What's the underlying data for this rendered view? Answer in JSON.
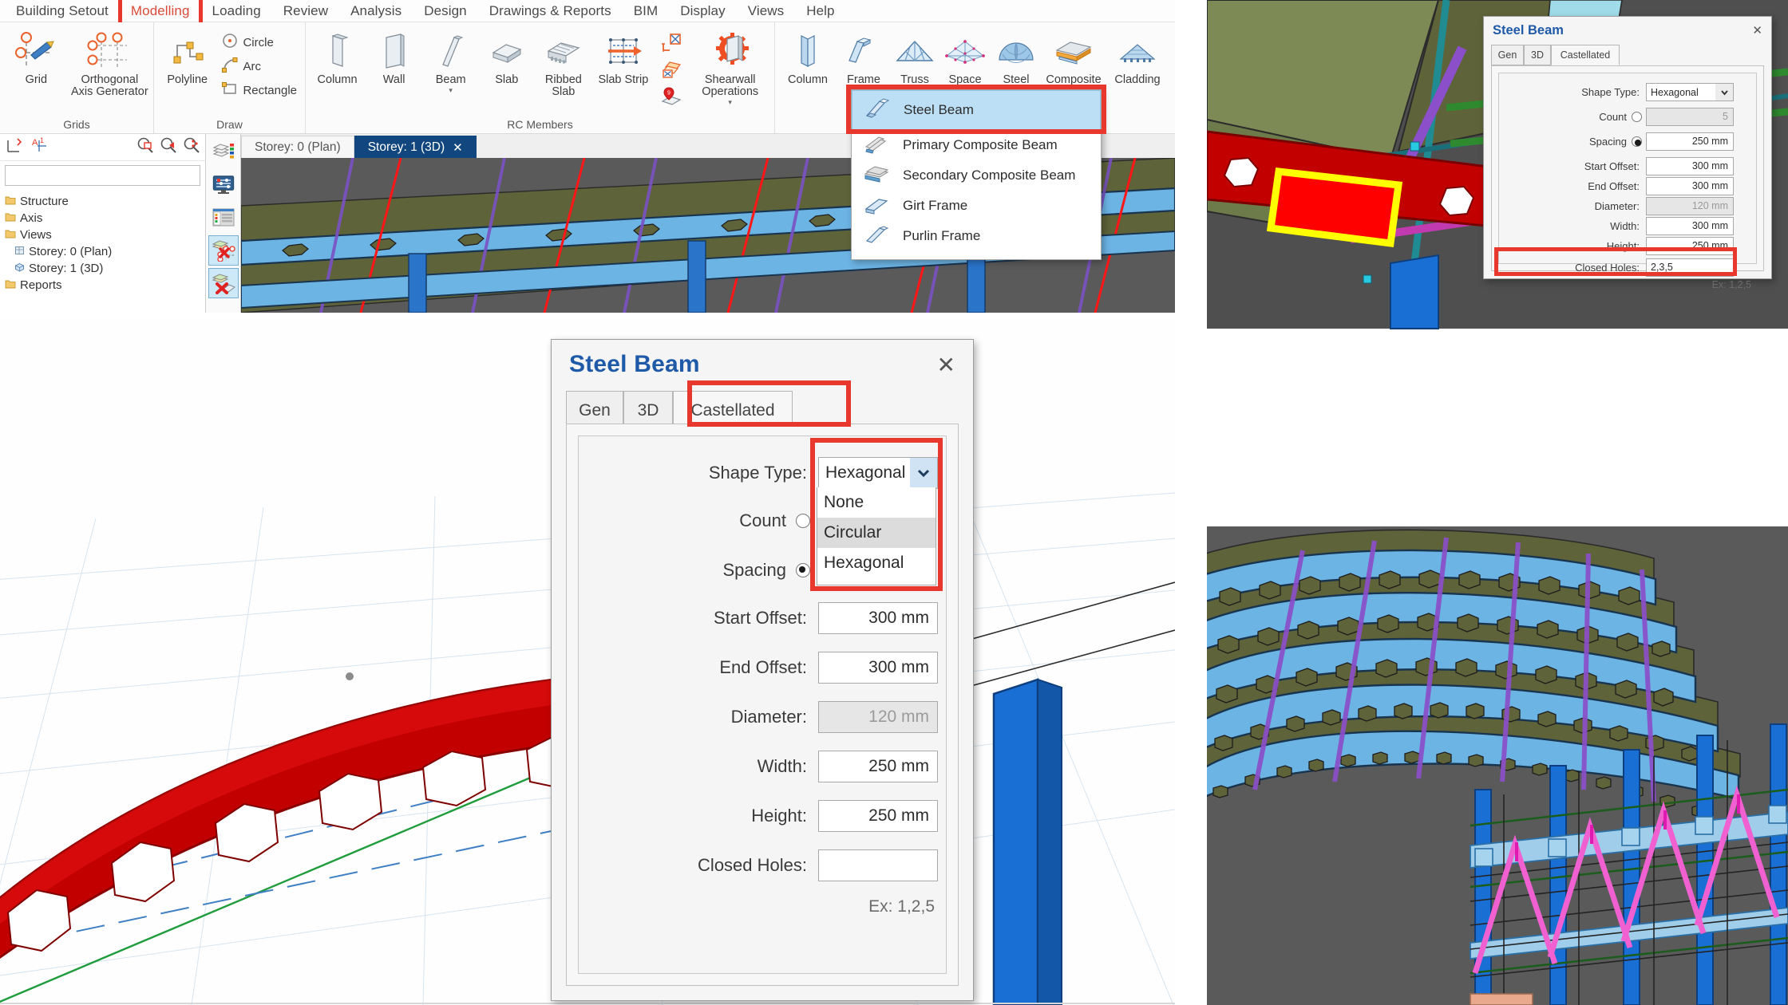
{
  "app": {
    "menu": [
      "Building Setout",
      "Modelling",
      "Loading",
      "Review",
      "Analysis",
      "Design",
      "Drawings & Reports",
      "BIM",
      "Display",
      "Views",
      "Help"
    ],
    "active_menu": "Modelling"
  },
  "ribbon": {
    "groups": [
      {
        "label": "Grids",
        "buttons": [
          {
            "name": "grid",
            "caption": "Grid",
            "icon": "grid-icon"
          },
          {
            "name": "orthogonal-axis-generator",
            "caption": "Orthogonal Axis Generator",
            "icon": "axis-generator-icon"
          }
        ]
      },
      {
        "label": "Draw",
        "buttons": [
          {
            "name": "polyline",
            "caption": "Polyline",
            "icon": "polyline-icon"
          }
        ],
        "small_buttons": [
          {
            "name": "circle",
            "caption": "Circle",
            "icon": "circle-icon"
          },
          {
            "name": "arc",
            "caption": "Arc",
            "icon": "arc-icon"
          },
          {
            "name": "rectangle",
            "caption": "Rectangle",
            "icon": "rectangle-icon"
          }
        ]
      },
      {
        "label": "RC Members",
        "buttons": [
          {
            "name": "column",
            "caption": "Column",
            "icon": "column-icon"
          },
          {
            "name": "wall",
            "caption": "Wall",
            "icon": "wall-icon"
          },
          {
            "name": "beam",
            "caption": "Beam",
            "icon": "beam-icon",
            "dropdown": true
          },
          {
            "name": "slab",
            "caption": "Slab",
            "icon": "slab-icon"
          },
          {
            "name": "ribbed-slab",
            "caption": "Ribbed Slab",
            "icon": "ribbed-slab-icon"
          },
          {
            "name": "slab-strip",
            "caption": "Slab Strip",
            "icon": "slab-strip-icon"
          },
          {
            "name": "shearwall-operations",
            "caption": "Shearwall Operations",
            "icon": "shearwall-icon",
            "dropdown": true
          }
        ]
      },
      {
        "label": "",
        "buttons": [
          {
            "name": "steel-column",
            "caption": "Column",
            "icon": "steel-column-icon"
          },
          {
            "name": "steel-frame",
            "caption": "Frame",
            "icon": "steel-frame-icon",
            "dropdown": true
          },
          {
            "name": "truss",
            "caption": "Truss",
            "icon": "truss-icon"
          },
          {
            "name": "space",
            "caption": "Space",
            "icon": "space-frame-icon"
          },
          {
            "name": "steel",
            "caption": "Steel",
            "icon": "steel-dome-icon"
          },
          {
            "name": "composite",
            "caption": "Composite",
            "icon": "composite-icon"
          },
          {
            "name": "cladding",
            "caption": "Cladding",
            "icon": "cladding-icon"
          }
        ]
      }
    ]
  },
  "beam_menu": {
    "items": [
      {
        "label": "Steel Beam",
        "icon": "i-beam-icon",
        "selected": true
      },
      {
        "label": "Primary Composite Beam",
        "icon": "primary-composite-icon",
        "selected": false
      },
      {
        "label": "Secondary Composite Beam",
        "icon": "secondary-composite-icon",
        "selected": false
      },
      {
        "label": "Girt Frame",
        "icon": "girt-icon",
        "selected": false
      },
      {
        "label": "Purlin Frame",
        "icon": "purlin-icon",
        "selected": false
      }
    ]
  },
  "sidebar": {
    "search_placeholder": "",
    "tree": [
      {
        "label": "Structure",
        "indent": 0,
        "icon": "folder-icon"
      },
      {
        "label": "Axis",
        "indent": 0,
        "icon": "folder-icon"
      },
      {
        "label": "Views",
        "indent": 0,
        "icon": "folder-icon"
      },
      {
        "label": "Storey: 0 (Plan)",
        "indent": 1,
        "icon": "plan-view-icon"
      },
      {
        "label": "Storey: 1 (3D)",
        "indent": 1,
        "icon": "3d-view-icon"
      },
      {
        "label": "Reports",
        "indent": 0,
        "icon": "folder-icon"
      }
    ]
  },
  "doctabs": [
    {
      "label": "Storey: 0 (Plan)",
      "active": false,
      "closable": false
    },
    {
      "label": "Storey: 1 (3D)",
      "active": true,
      "closable": true,
      "close_glyph": "✕"
    }
  ],
  "dialog_main": {
    "title": "Steel Beam",
    "close_glyph": "✕",
    "tabs": [
      {
        "label": "Gen",
        "active": false
      },
      {
        "label": "3D",
        "active": false
      },
      {
        "label": "Castellated",
        "active": true,
        "highlighted": true
      }
    ],
    "fields": [
      {
        "name": "shape-type",
        "label": "Shape Type:",
        "type": "combo",
        "value": "Hexagonal",
        "highlighted": true
      },
      {
        "name": "count",
        "label": "Count",
        "type": "radio",
        "checked": false,
        "value": ""
      },
      {
        "name": "spacing",
        "label": "Spacing",
        "type": "radio",
        "checked": true,
        "value": ""
      },
      {
        "name": "start-offset",
        "label": "Start Offset:",
        "type": "text",
        "value": "300 mm",
        "disabled": false
      },
      {
        "name": "end-offset",
        "label": "End Offset:",
        "type": "text",
        "value": "300 mm",
        "disabled": false
      },
      {
        "name": "diameter",
        "label": "Diameter:",
        "type": "text",
        "value": "120 mm",
        "disabled": true
      },
      {
        "name": "width",
        "label": "Width:",
        "type": "text",
        "value": "250 mm",
        "disabled": false
      },
      {
        "name": "height",
        "label": "Height:",
        "type": "text",
        "value": "250 mm",
        "disabled": false
      },
      {
        "name": "closed-holes",
        "label": "Closed Holes:",
        "type": "text",
        "value": "",
        "disabled": false
      }
    ],
    "hint": "Ex: 1,2,5",
    "dropdown_open": true,
    "dropdown_options": [
      {
        "label": "None",
        "highlighted": false
      },
      {
        "label": "Circular",
        "highlighted": true
      },
      {
        "label": "Hexagonal",
        "highlighted": false
      }
    ]
  },
  "dialog_small": {
    "title": "Steel Beam",
    "close_glyph": "✕",
    "tabs": [
      {
        "label": "Gen",
        "active": false
      },
      {
        "label": "3D",
        "active": false
      },
      {
        "label": "Castellated",
        "active": true
      }
    ],
    "fields": [
      {
        "name": "shape-type",
        "label": "Shape Type:",
        "type": "combo",
        "value": "Hexagonal"
      },
      {
        "name": "count",
        "label": "Count",
        "type": "radio",
        "checked": false,
        "value": "5",
        "disabled": true
      },
      {
        "name": "spacing",
        "label": "Spacing",
        "type": "radio",
        "checked": true,
        "value": "250 mm",
        "disabled": false
      },
      {
        "name": "start-offset",
        "label": "Start Offset:",
        "type": "text",
        "value": "300 mm",
        "disabled": false
      },
      {
        "name": "end-offset",
        "label": "End Offset:",
        "type": "text",
        "value": "300 mm",
        "disabled": false
      },
      {
        "name": "diameter",
        "label": "Diameter:",
        "type": "text",
        "value": "120 mm",
        "disabled": true
      },
      {
        "name": "width",
        "label": "Width:",
        "type": "text",
        "value": "300 mm",
        "disabled": false
      },
      {
        "name": "height",
        "label": "Height:",
        "type": "text",
        "value": "250 mm",
        "disabled": false
      },
      {
        "name": "closed-holes",
        "label": "Closed Holes:",
        "type": "text",
        "value": "2,3,5",
        "disabled": false,
        "highlighted": true
      }
    ],
    "hint": "Ex: 1,2,5"
  },
  "colors": {
    "accent_red": "#e8372c",
    "dialog_title_blue": "#1f5aa8",
    "tab_active_blue": "#11477e",
    "menu_active_red": "#d94a3a",
    "beam_red": "#cc0000",
    "beam_blue": "#6cb4e4",
    "roof_olive": "#5f6339",
    "brace_pink": "#e86fd0",
    "column_blue": "#2a74c9",
    "viewport_gray": "#5a5a5a",
    "highlight_yellow": "#ffff00",
    "selection_blue": "#bcdff5"
  }
}
